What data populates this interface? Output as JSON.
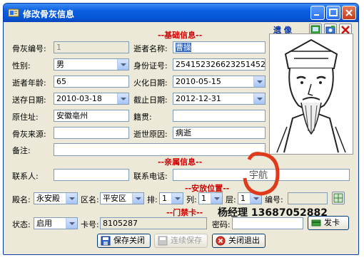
{
  "window": {
    "title": "修改骨灰信息"
  },
  "sections": {
    "basic": "--基础信息--",
    "family": "--亲属信息--",
    "placement": "--安放位置--",
    "card": "--门禁卡--"
  },
  "basic": {
    "ash_no_label": "骨灰编号:",
    "ash_no_value": "1",
    "name_label": "逝者名称:",
    "name_value": "曹操",
    "gender_label": "性别:",
    "gender_value": "男",
    "id_label": "身份证号:",
    "id_value": "254152326623251452",
    "age_label": "逝者年龄:",
    "age_value": "65",
    "cremation_label": "火化日期:",
    "cremation_value": "2010-05-15",
    "deliver_label": "送存日期:",
    "deliver_value": "2010-03-18",
    "expire_label": "截止日期:",
    "expire_value": "2012-12-31",
    "address_label": "原住址:",
    "address_value": "安徽亳州",
    "origin_label": "籍贯:",
    "origin_value": "",
    "source_label": "骨灰来源:",
    "source_value": "",
    "cause_label": "逝世原因:",
    "cause_value": "病逝",
    "remark_label": "备注:",
    "remark_value": ""
  },
  "portrait": {
    "label": "遗 像"
  },
  "family": {
    "contact_label": "联系人:",
    "contact_value": "",
    "phone_label": "联系电话:",
    "phone_value": ""
  },
  "placement": {
    "hall_label": "殿名:",
    "hall_value": "永安殿",
    "area_label": "区名:",
    "area_value": "平安区",
    "row_label": "排:",
    "row_value": "1",
    "col_label": "列:",
    "col_value": "1",
    "layer_label": "层:",
    "layer_value": "1",
    "code_label": "编号:",
    "code_value": ""
  },
  "card": {
    "status_label": "状态:",
    "status_value": "启用",
    "card_no_label": "卡号:",
    "card_no_value": "8105287",
    "password_label": "密码:",
    "password_value": "",
    "issue_button": "发卡"
  },
  "buttons": {
    "save_close": "保存关闭",
    "continue_save": "连续保存",
    "close_exit": "关闭退出"
  },
  "overlay": {
    "text": "杨经理  13687052882"
  },
  "watermark": {
    "text": "宇航"
  },
  "colors": {
    "section_red": "#d00000",
    "titlebar_blue": "#0a5ee0",
    "watermark_red": "#e03a1a"
  }
}
